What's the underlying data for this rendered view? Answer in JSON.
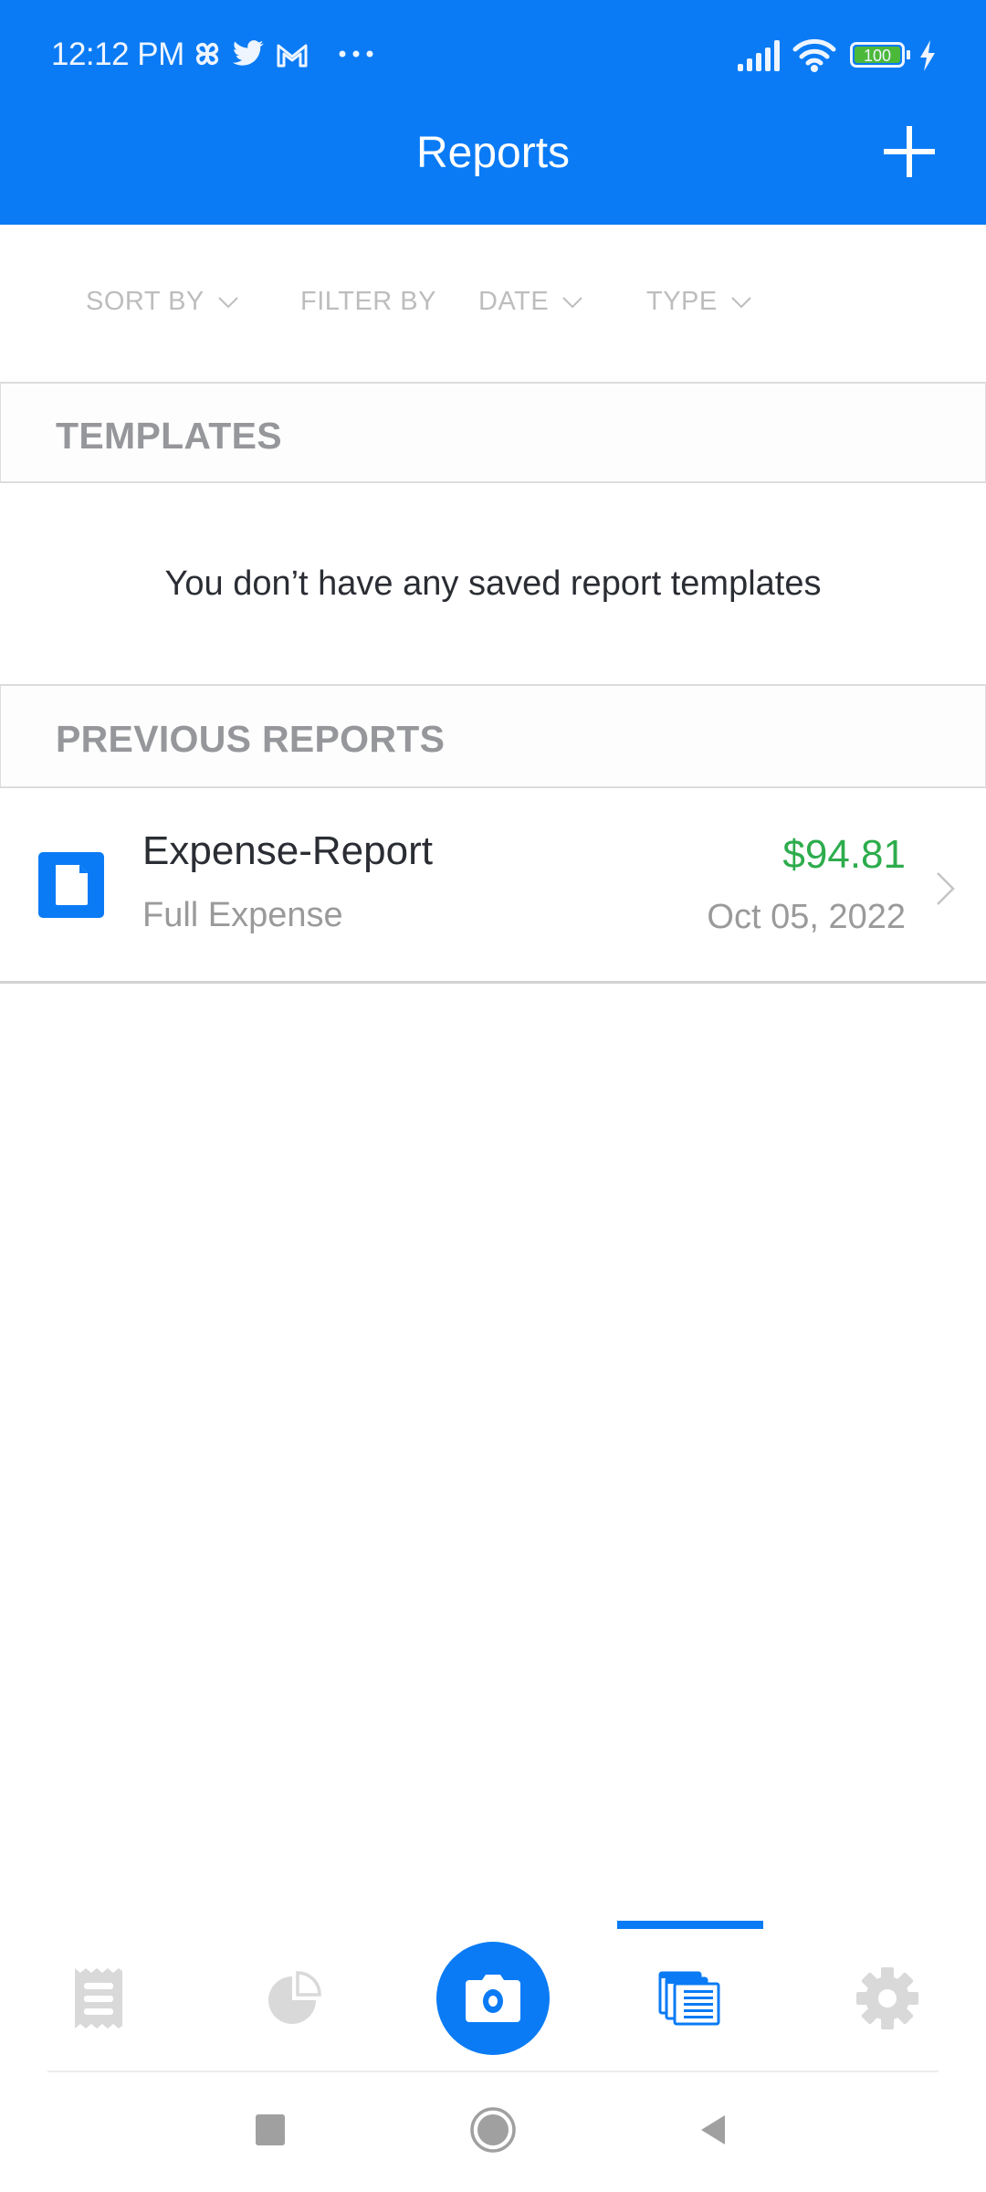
{
  "status_bar": {
    "time": "12:12 PM",
    "notification_icons": [
      "pinwheel-icon",
      "twitter-icon",
      "gmail-icon",
      "more-dots-icon"
    ],
    "battery_level": "100",
    "system_icons": [
      "signal-icon",
      "wifi-icon",
      "battery-icon",
      "charging-icon"
    ]
  },
  "header": {
    "title": "Reports",
    "add_icon": "plus-icon"
  },
  "filters": {
    "sort_by": "SORT BY",
    "filter_by": "FILTER BY",
    "date": "DATE",
    "type": "TYPE"
  },
  "templates": {
    "heading": "TEMPLATES",
    "empty_message": "You don’t have any saved report templates"
  },
  "previous_reports": {
    "heading": "PREVIOUS REPORTS",
    "items": [
      {
        "name": "Expense-Report",
        "type": "Full Expense",
        "amount": "$94.81",
        "date": "Oct 05, 2022"
      }
    ]
  },
  "bottom_nav": {
    "tabs": [
      {
        "name": "receipts",
        "icon": "receipt-icon",
        "active": false
      },
      {
        "name": "analytics",
        "icon": "pie-chart-icon",
        "active": false
      },
      {
        "name": "camera",
        "icon": "camera-icon",
        "active": false
      },
      {
        "name": "reports",
        "icon": "reports-icon",
        "active": true
      },
      {
        "name": "settings",
        "icon": "gear-icon",
        "active": false
      }
    ]
  },
  "system_nav": [
    "recents-button",
    "home-button",
    "back-button"
  ],
  "colors": {
    "brand_blue": "#0a7bf5",
    "amount_green": "#2dac4c",
    "inactive_icon": "#d9d9d9"
  }
}
